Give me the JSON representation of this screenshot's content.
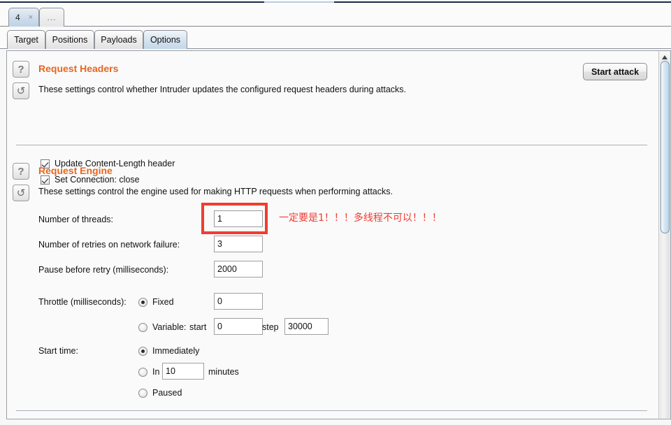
{
  "outer_tabs": {
    "selected": {
      "label": "4",
      "close_label": "×"
    },
    "more": {
      "label": "..."
    }
  },
  "inner_tabs": [
    {
      "label": "Target",
      "active": false
    },
    {
      "label": "Positions",
      "active": false
    },
    {
      "label": "Payloads",
      "active": false
    },
    {
      "label": "Options",
      "active": true
    }
  ],
  "toolbar": {
    "start_attack_label": "Start attack"
  },
  "icons": {
    "help_glyph": "?",
    "reset_glyph": "↺",
    "scroll_up": "▲"
  },
  "request_headers": {
    "title": "Request Headers",
    "description": "These settings control whether Intruder updates the configured request headers during attacks.",
    "checkboxes": [
      {
        "label": "Update Content-Length header",
        "checked": true
      },
      {
        "label": "Set Connection: close",
        "checked": true
      }
    ]
  },
  "request_engine": {
    "title": "Request Engine",
    "description": "These settings control the engine used for making HTTP requests when performing attacks.",
    "threads": {
      "label": "Number of threads:",
      "value": "1"
    },
    "retries": {
      "label": "Number of retries on network failure:",
      "value": "3"
    },
    "pause": {
      "label": "Pause before retry (milliseconds):",
      "value": "2000"
    },
    "throttle": {
      "label": "Throttle (milliseconds):",
      "fixed": {
        "label": "Fixed",
        "selected": true,
        "value": "0"
      },
      "variable": {
        "label": "Variable:",
        "selected": false,
        "start_label": "start",
        "start_value": "0",
        "step_label": "step",
        "step_value": "30000"
      }
    },
    "start_time": {
      "label": "Start time:",
      "immediately": {
        "label": "Immediately",
        "selected": true
      },
      "in": {
        "label": "In",
        "selected": false,
        "value": "10",
        "unit_label": "minutes"
      },
      "paused": {
        "label": "Paused",
        "selected": false
      }
    }
  },
  "annotation": {
    "text": "一定要是1！！！多线程不可以！！！",
    "color": "#ef3b30"
  },
  "colors": {
    "section_title": "#e8661d",
    "highlight": "#f23c2e",
    "tab_active": "#c4d7e8",
    "panel_bg": "#fafafa"
  }
}
